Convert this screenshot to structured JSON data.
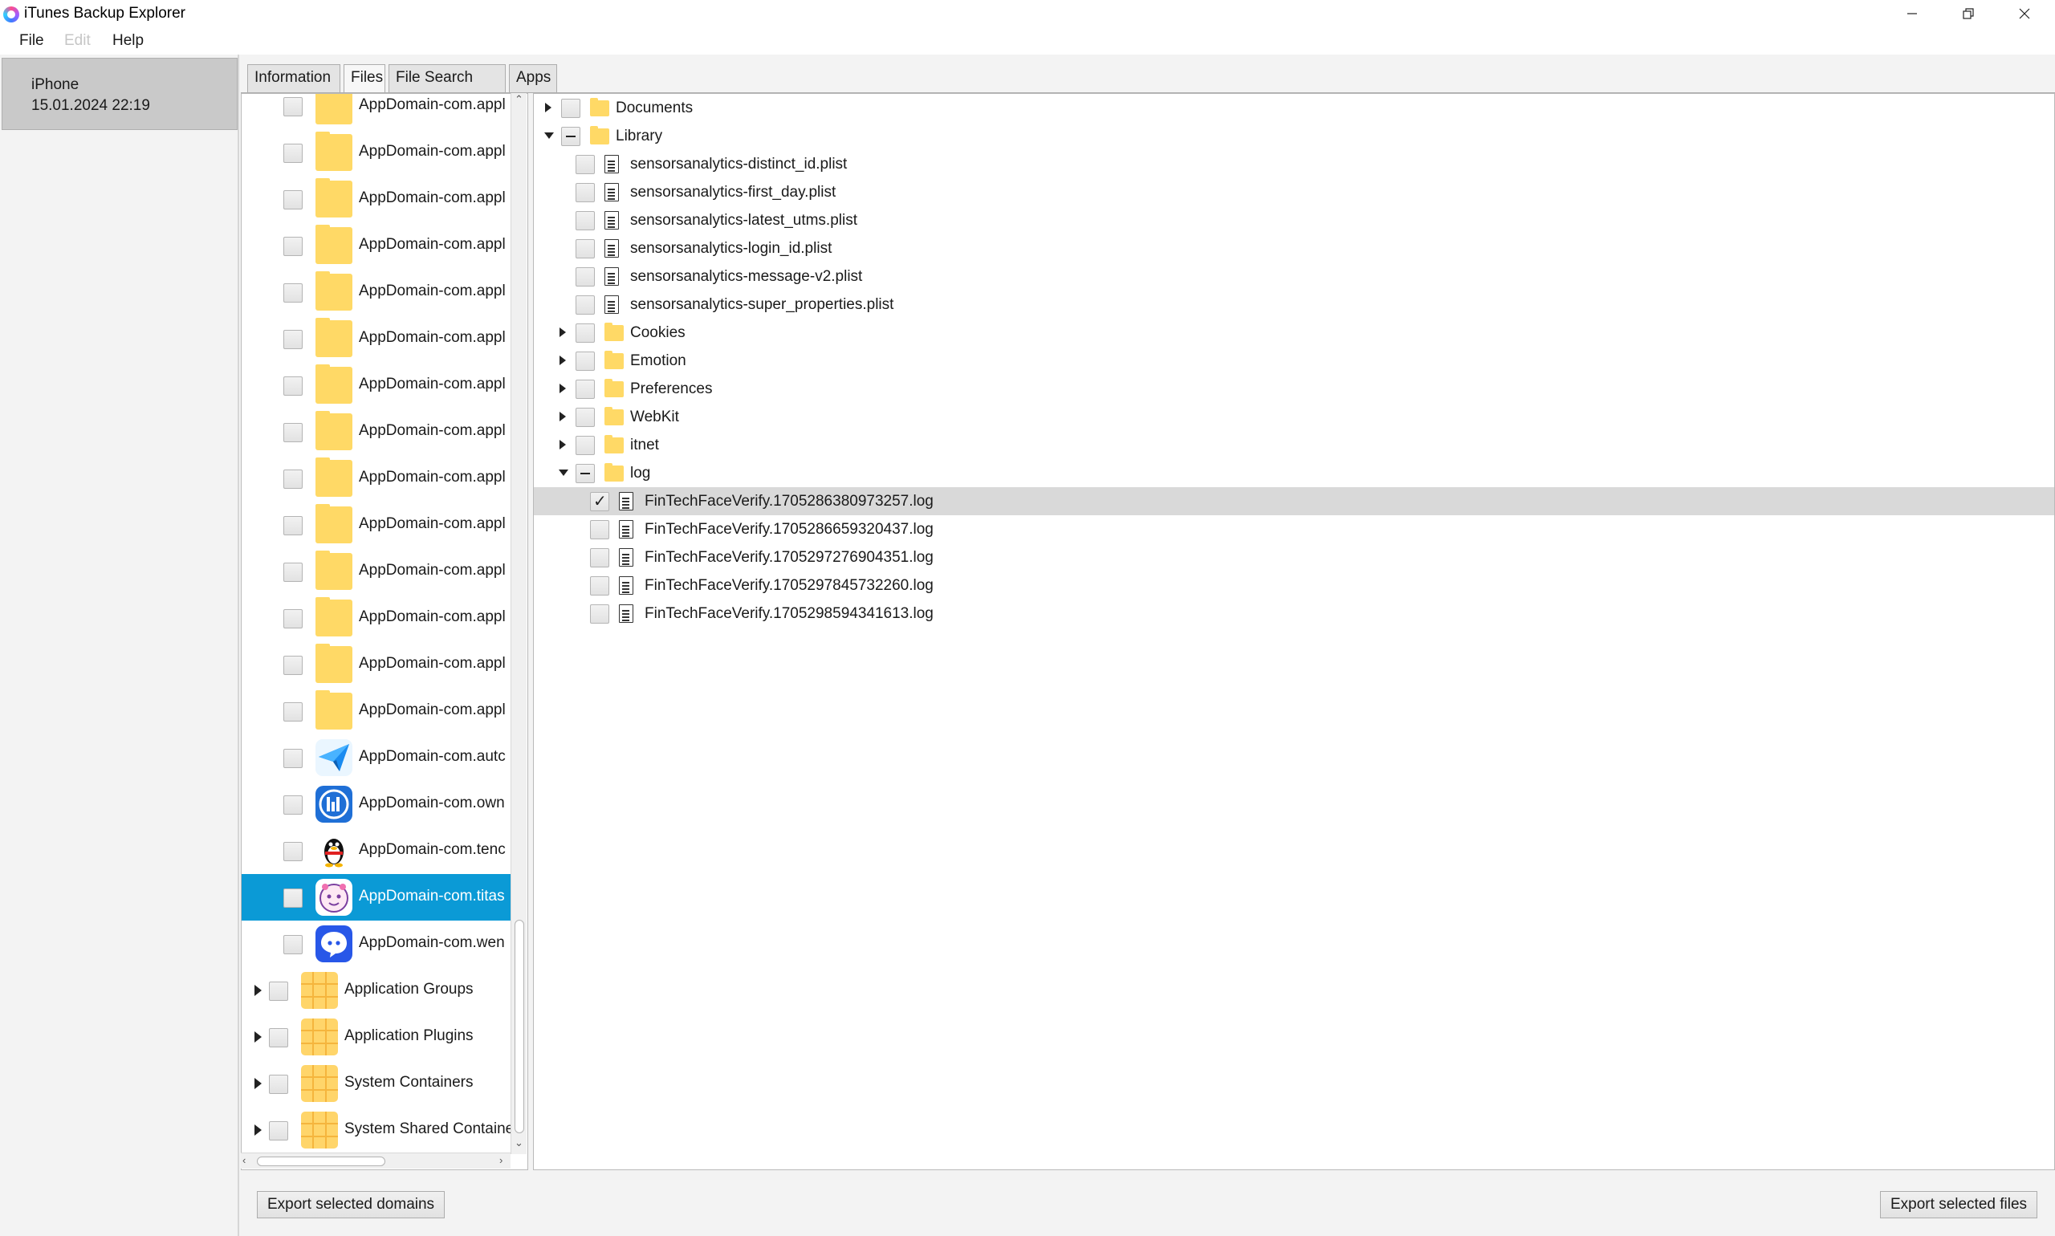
{
  "window": {
    "title": "iTunes Backup Explorer"
  },
  "menu": {
    "file": "File",
    "edit": "Edit",
    "help": "Help"
  },
  "device": {
    "name": "iPhone",
    "date": "15.01.2024 22:19"
  },
  "tabs": [
    {
      "label": "Information"
    },
    {
      "label": "Files"
    },
    {
      "label": "File Search"
    },
    {
      "label": "Apps"
    }
  ],
  "domains": [
    {
      "label": "AppDomain-com.appl",
      "icon": "folder-icon"
    },
    {
      "label": "AppDomain-com.appl",
      "icon": "folder-icon"
    },
    {
      "label": "AppDomain-com.appl",
      "icon": "folder-icon"
    },
    {
      "label": "AppDomain-com.appl",
      "icon": "folder-icon"
    },
    {
      "label": "AppDomain-com.appl",
      "icon": "folder-icon"
    },
    {
      "label": "AppDomain-com.appl",
      "icon": "folder-icon"
    },
    {
      "label": "AppDomain-com.appl",
      "icon": "folder-icon"
    },
    {
      "label": "AppDomain-com.appl",
      "icon": "folder-icon"
    },
    {
      "label": "AppDomain-com.appl",
      "icon": "folder-icon"
    },
    {
      "label": "AppDomain-com.appl",
      "icon": "folder-icon"
    },
    {
      "label": "AppDomain-com.appl",
      "icon": "folder-icon"
    },
    {
      "label": "AppDomain-com.appl",
      "icon": "folder-icon"
    },
    {
      "label": "AppDomain-com.appl",
      "icon": "folder-icon"
    },
    {
      "label": "AppDomain-com.appl",
      "icon": "folder-icon"
    },
    {
      "label": "AppDomain-com.autc",
      "icon": "paper-plane-icon"
    },
    {
      "label": "AppDomain-com.own",
      "icon": "app-logo-icon"
    },
    {
      "label": "AppDomain-com.tenc",
      "icon": "penguin-icon"
    },
    {
      "label": "AppDomain-com.titas",
      "icon": "cartoon-face-icon",
      "selected": true
    },
    {
      "label": "AppDomain-com.wen",
      "icon": "chat-bubble-icon"
    }
  ],
  "groups": [
    {
      "label": "Application Groups"
    },
    {
      "label": "Application Plugins"
    },
    {
      "label": "System Containers"
    },
    {
      "label": "System Shared Containe"
    }
  ],
  "files": {
    "documents": "Documents",
    "library": "Library",
    "library_files": [
      "sensorsanalytics-distinct_id.plist",
      "sensorsanalytics-first_day.plist",
      "sensorsanalytics-latest_utms.plist",
      "sensorsanalytics-login_id.plist",
      "sensorsanalytics-message-v2.plist",
      "sensorsanalytics-super_properties.plist"
    ],
    "library_folders": [
      "Cookies",
      "Emotion",
      "Preferences",
      "WebKit",
      "itnet"
    ],
    "log": "log",
    "log_files": [
      "FinTechFaceVerify.1705286380973257.log",
      "FinTechFaceVerify.1705286659320437.log",
      "FinTechFaceVerify.1705297276904351.log",
      "FinTechFaceVerify.1705297845732260.log",
      "FinTechFaceVerify.1705298594341613.log"
    ]
  },
  "buttons": {
    "export_domains": "Export selected domains",
    "export_files": "Export selected files"
  },
  "colors": {
    "selection": "#0b9ad6",
    "folder": "#ffd966"
  }
}
